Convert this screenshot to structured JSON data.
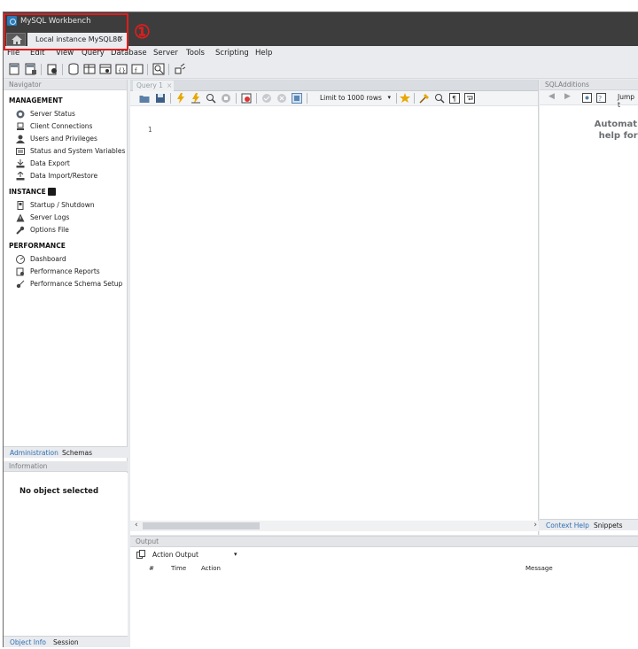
{
  "window": {
    "title": "MySQL Workbench"
  },
  "tabs": {
    "home_icon": "home-icon",
    "connection_tab": "Local instance MySQL80",
    "close_glyph": "×"
  },
  "annotation": {
    "marker": "①",
    "color": "#e11d1d"
  },
  "menu": [
    "File",
    "Edit",
    "View",
    "Query",
    "Database",
    "Server",
    "Tools",
    "Scripting",
    "Help"
  ],
  "navigator": {
    "header": "Navigator",
    "management": {
      "title": "MANAGEMENT",
      "items": [
        "Server Status",
        "Client Connections",
        "Users and Privileges",
        "Status and System Variables",
        "Data Export",
        "Data Import/Restore"
      ]
    },
    "instance": {
      "title": "INSTANCE",
      "items": [
        "Startup / Shutdown",
        "Server Logs",
        "Options File"
      ]
    },
    "performance": {
      "title": "PERFORMANCE",
      "items": [
        "Dashboard",
        "Performance Reports",
        "Performance Schema Setup"
      ]
    },
    "tabs": [
      "Administration",
      "Schemas"
    ],
    "info_header": "Information",
    "info_text": "No object selected",
    "bottom_tabs": [
      "Object Info",
      "Session"
    ]
  },
  "editor": {
    "tab": "Query 1",
    "limit": "Limit to 1000 rows",
    "line_number": "1"
  },
  "sql_additions": {
    "header": "SQLAdditions",
    "jump": "Jump t",
    "text_line1": "Automatic conte",
    "text_line2": "help for the cu",
    "tabs": [
      "Context Help",
      "Snippets"
    ]
  },
  "output": {
    "header": "Output",
    "select": "Action Output",
    "columns": [
      "#",
      "Time",
      "Action",
      "Message"
    ]
  },
  "colors": {
    "accent": "#2f6fb3",
    "titlebar": "#3d3d3d"
  }
}
